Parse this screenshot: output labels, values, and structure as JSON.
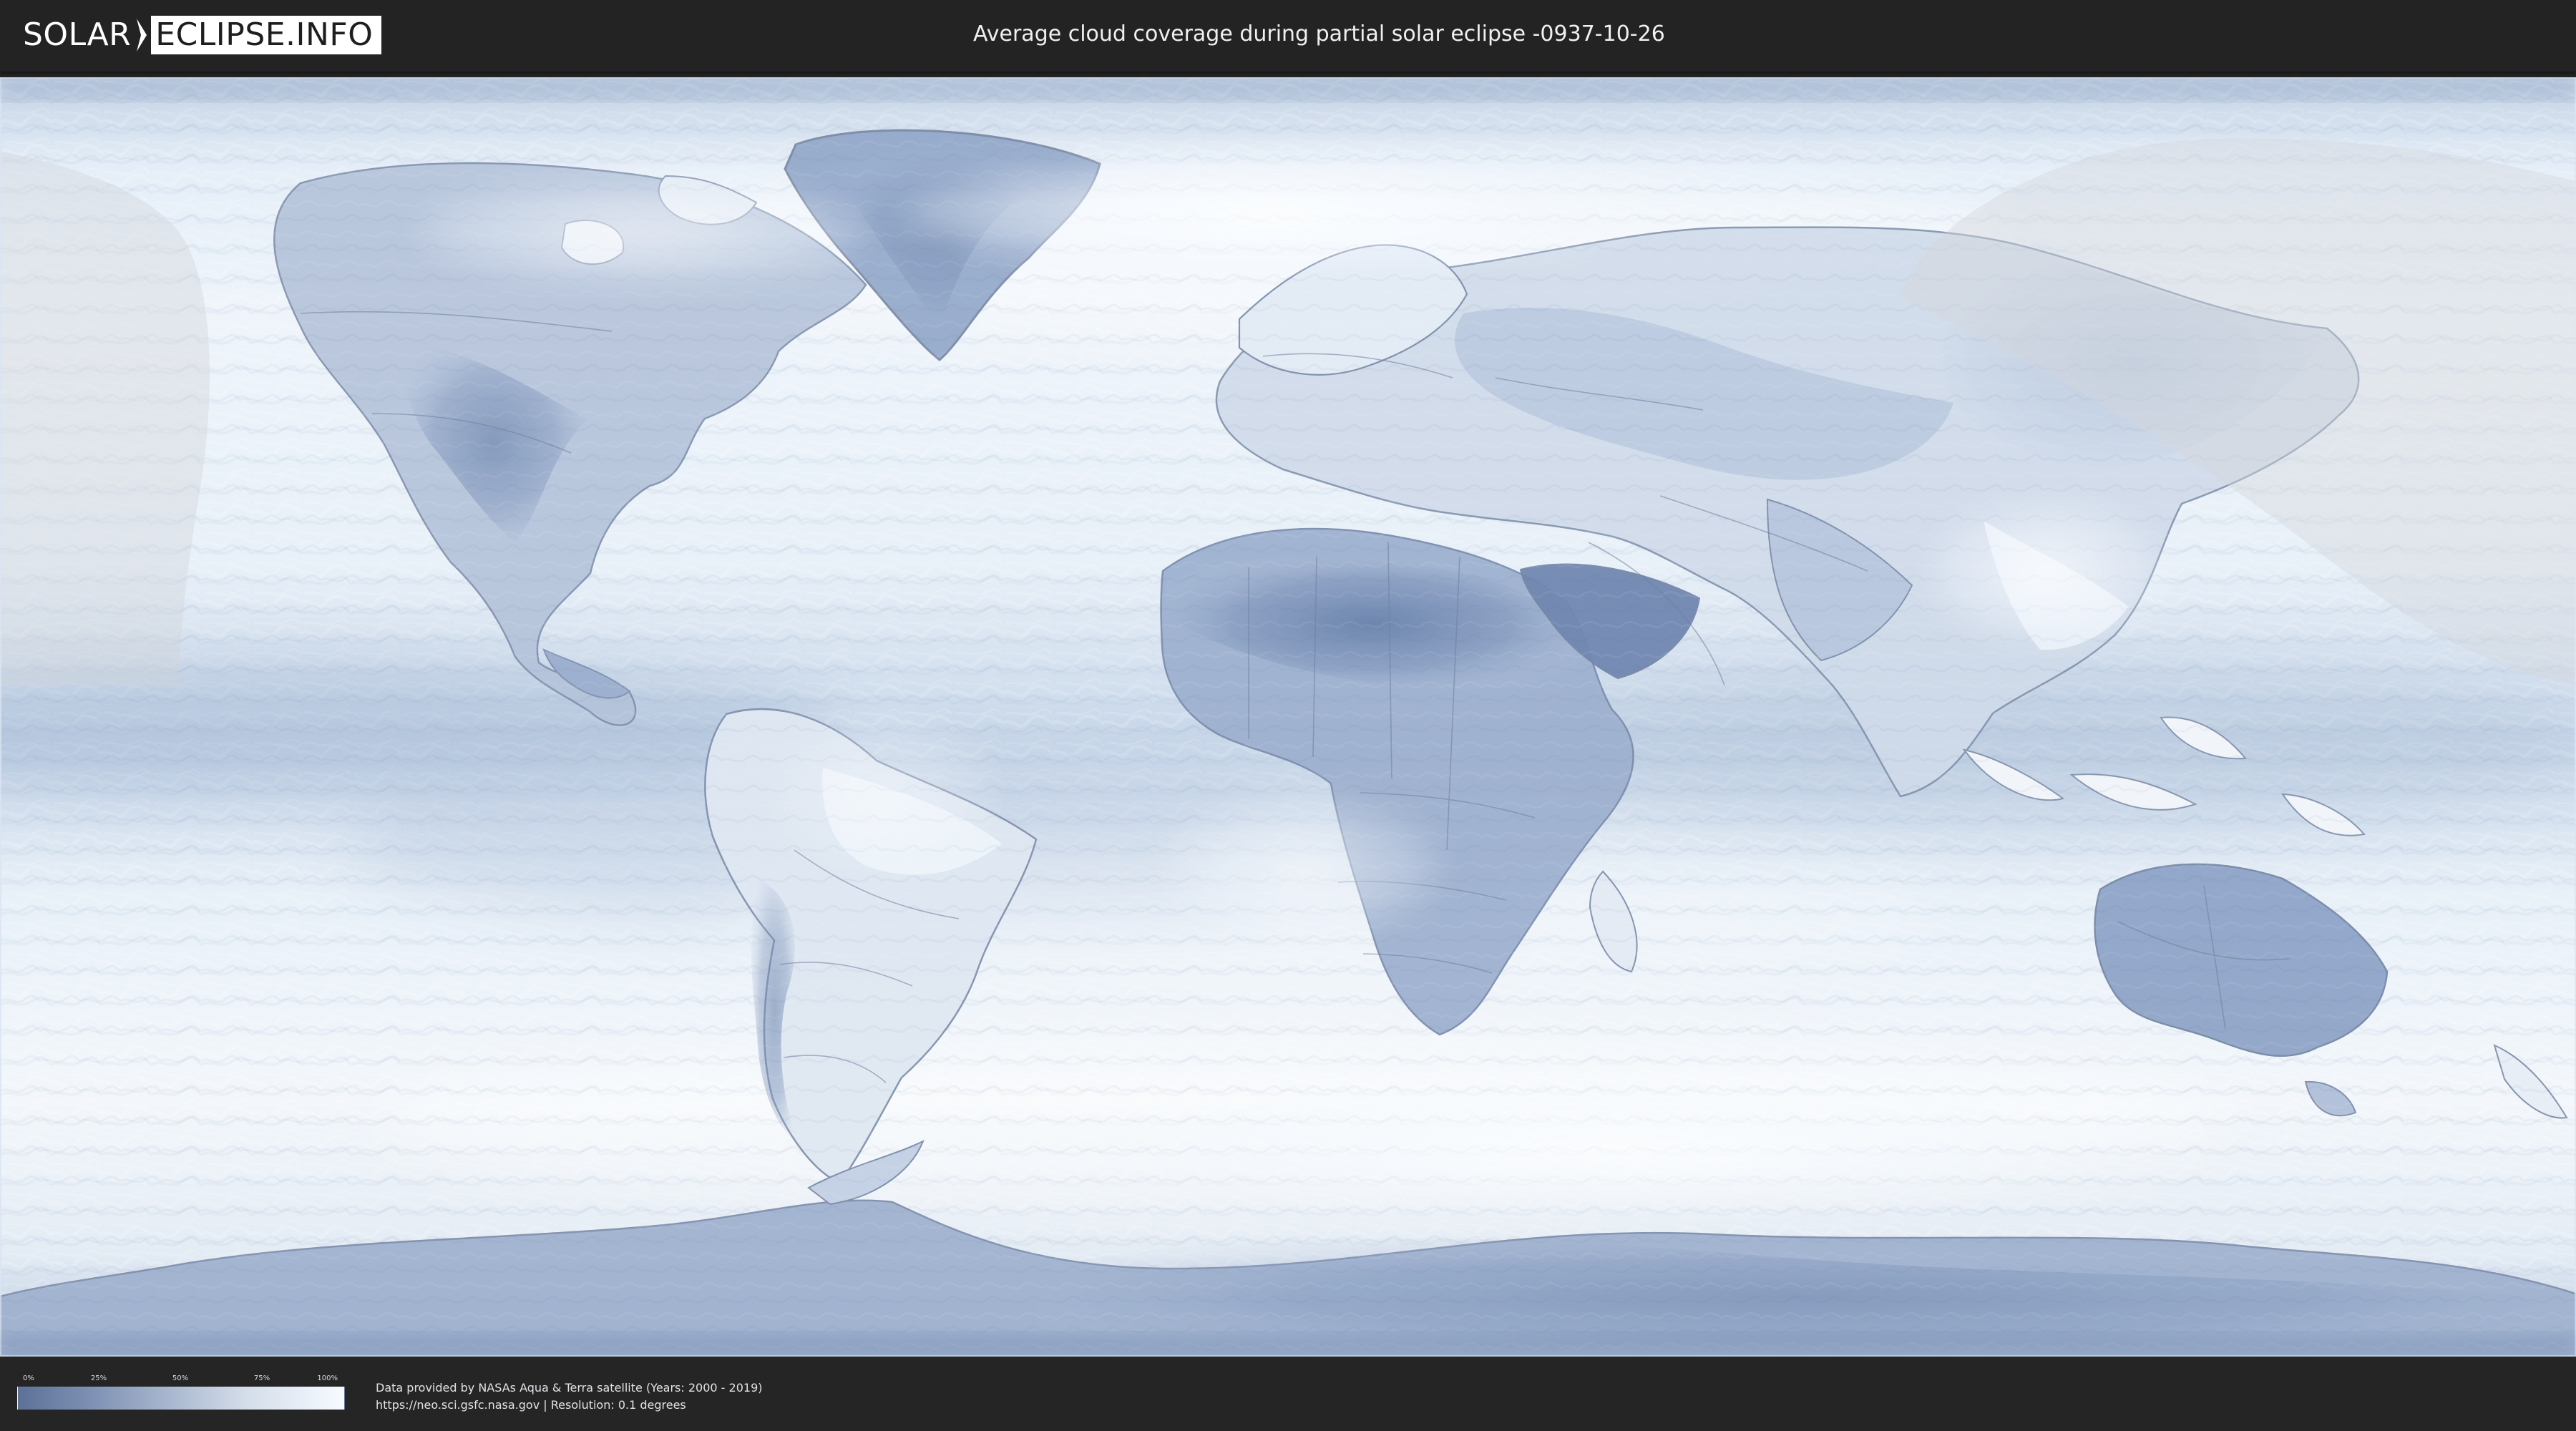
{
  "header": {
    "logo_left": "SOLAR",
    "logo_right": "ECLIPSE.INFO",
    "title": "Average cloud coverage during partial solar eclipse -0937-10-26"
  },
  "map": {
    "projection": "equirectangular world map",
    "style": "cloud coverage average overlay with partial eclipse visibility zones",
    "colors": {
      "ocean_cloud_light": "#eef4fa",
      "clear_blue": "#6f86b0",
      "mid_blue": "#9fb3d0",
      "eclipse_shadow": "#d8dbe0",
      "borders": "#7c8da7"
    }
  },
  "legend": {
    "ticks": [
      "0%",
      "25%",
      "50%",
      "75%",
      "100%"
    ]
  },
  "footer": {
    "source_line": "Data provided by NASAs Aqua & Terra satellite (Years: 2000 - 2019)",
    "url_text": "https://neo.sci.gsfc.nasa.gov",
    "resolution_text": " | Resolution: 0.1 degrees"
  }
}
